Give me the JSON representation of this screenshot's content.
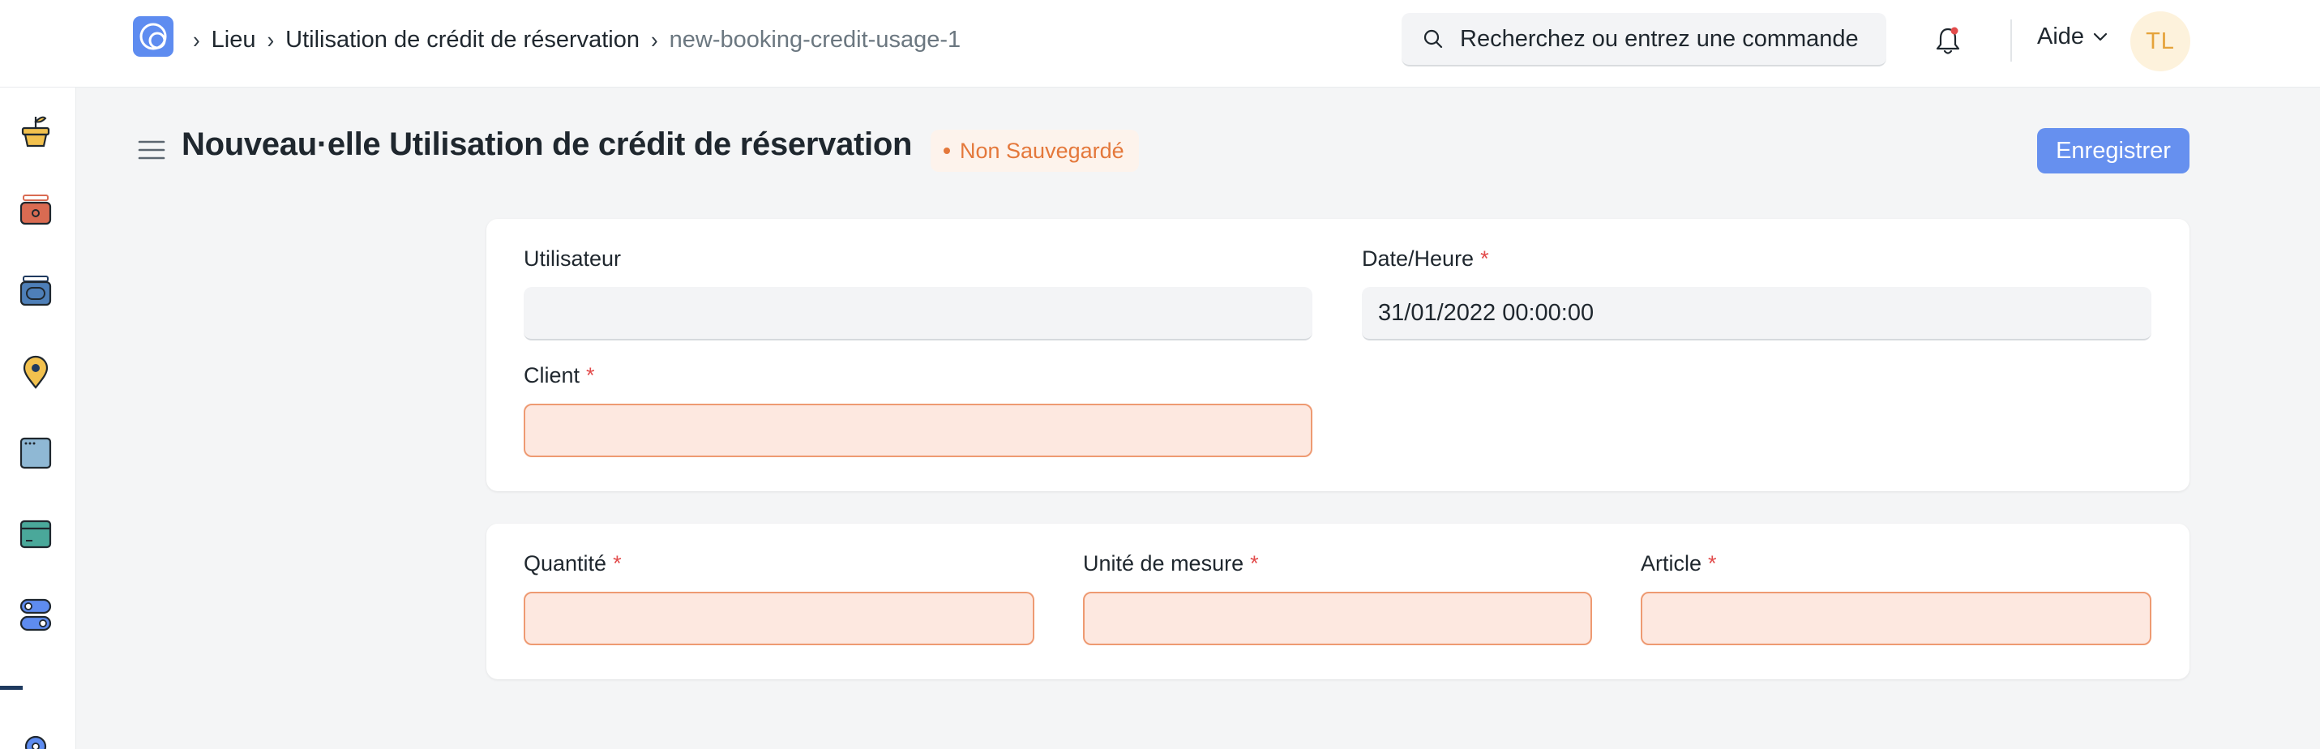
{
  "breadcrumb": {
    "items": [
      "Lieu",
      "Utilisation de crédit de réservation",
      "new-booking-credit-usage-1"
    ]
  },
  "search": {
    "placeholder": "Recherchez ou entrez une commande"
  },
  "help": {
    "label": "Aide"
  },
  "user": {
    "initials": "TL"
  },
  "page": {
    "title": "Nouveau·elle Utilisation de crédit de réservation",
    "status": "Non Sauvegardé",
    "save_label": "Enregistrer"
  },
  "form": {
    "section1": {
      "utilisateur": {
        "label": "Utilisateur",
        "value": "",
        "required": false
      },
      "date_heure": {
        "label": "Date/Heure",
        "value": "31/01/2022 00:00:00",
        "required": true
      },
      "client": {
        "label": "Client",
        "value": "",
        "required": true
      }
    },
    "section2": {
      "quantite": {
        "label": "Quantité",
        "value": "",
        "required": true
      },
      "unite": {
        "label": "Unité de mesure",
        "value": "",
        "required": true
      },
      "article": {
        "label": "Article",
        "value": "",
        "required": true
      }
    },
    "required_marker": "*"
  },
  "sidebar": {
    "icons": [
      "plant-pot-icon",
      "camera-icon",
      "wallet-icon",
      "map-pin-icon",
      "browser-window-icon",
      "card-icon",
      "toggle-icon",
      "gear-icon"
    ]
  },
  "colors": {
    "accent": "#6690ef",
    "status": "#e4783b",
    "required": "#e24c4c",
    "invalid_bg": "#fde8e0",
    "invalid_border": "#ee9a72"
  }
}
